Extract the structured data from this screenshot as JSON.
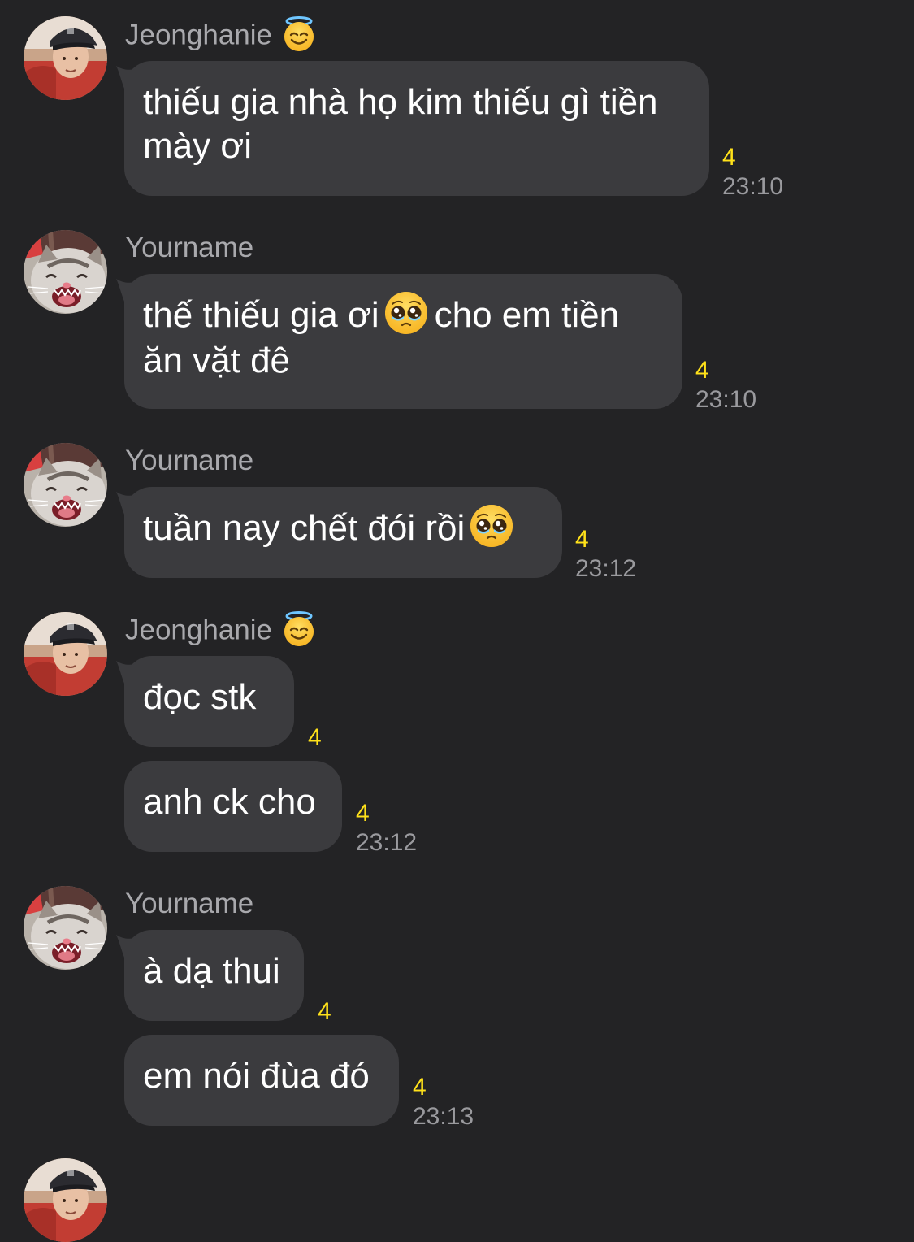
{
  "messages": [
    {
      "sender": "Jeonghanie",
      "sender_badge": "smiling-face-with-halo-emoji",
      "avatar": "person-with-cap-avatar",
      "bubbles": [
        {
          "text": "thiếu gia nhà họ kim thiếu gì tiền\nmày ơi",
          "seen_count": "4",
          "time": "23:10"
        }
      ]
    },
    {
      "sender": "Yourname",
      "avatar": "crying-cat-avatar",
      "bubbles": [
        {
          "text_before": "thế thiếu gia ơi",
          "emoji": "pleading-face-emoji",
          "text_after": "cho em tiền",
          "text_line2": "ăn vặt đê",
          "seen_count": "4",
          "time": "23:10"
        }
      ]
    },
    {
      "sender": "Yourname",
      "avatar": "crying-cat-avatar",
      "bubbles": [
        {
          "text_before": "tuần nay chết đói rồi",
          "emoji": "pleading-face-emoji",
          "seen_count": "4",
          "time": "23:12"
        }
      ]
    },
    {
      "sender": "Jeonghanie",
      "sender_badge": "smiling-face-with-halo-emoji",
      "avatar": "person-with-cap-avatar",
      "bubbles": [
        {
          "text": "đọc stk",
          "seen_count": "4"
        },
        {
          "text": "anh ck cho",
          "seen_count": "4",
          "time": "23:12"
        }
      ]
    },
    {
      "sender": "Yourname",
      "avatar": "crying-cat-avatar",
      "bubbles": [
        {
          "text": "à dạ thui",
          "seen_count": "4"
        },
        {
          "text": "em nói đùa đó",
          "seen_count": "4",
          "time": "23:13"
        }
      ]
    }
  ],
  "colors": {
    "background": "#232325",
    "bubble": "#3b3b3e",
    "sender_name": "#a9a9ad",
    "seen_count": "#ffe11a",
    "timestamp": "#9a9a9e"
  }
}
